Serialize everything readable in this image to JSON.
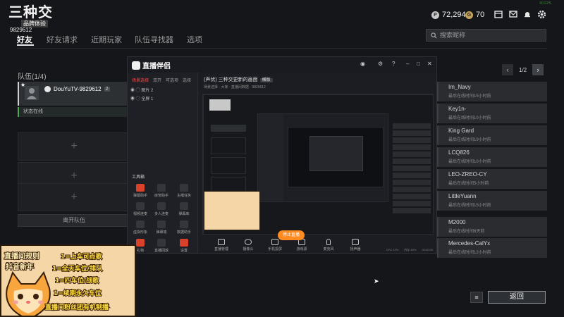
{
  "header": {
    "logo_text": "三种交",
    "logo_sub": "品牌体验",
    "player_id": "9829612",
    "coins": "72,294",
    "gems": "70",
    "fps": "60 FPS"
  },
  "tabs": [
    {
      "label": "好友",
      "active": true
    },
    {
      "label": "好友请求",
      "active": false
    },
    {
      "label": "近期玩家",
      "active": false
    },
    {
      "label": "队伍寻找器",
      "active": false
    },
    {
      "label": "选项",
      "active": false
    }
  ],
  "search": {
    "placeholder": "搜索昵称"
  },
  "party": {
    "title": "队伍(1/4)",
    "member_name": "DouYuTV-9829612",
    "member_level": "2",
    "member_status": "状态在线",
    "leave_label": "离开队伍"
  },
  "pager": {
    "label": "1/2"
  },
  "friends": [
    {
      "name": "Im_Navy",
      "status": "最后在线时间15小时前"
    },
    {
      "name": "Key1n-",
      "status": "最后在线时间10小时前"
    },
    {
      "name": "King Gard",
      "status": "最后在线时间19小时前"
    },
    {
      "name": "LCQ826",
      "status": "最后在线时间10小时前"
    },
    {
      "name": "LEO-ZREO-CY",
      "status": "最后在线时间5小时前"
    },
    {
      "name": "LittleYuann",
      "status": "最后在线时间15小时前"
    },
    {
      "name": "M2000",
      "status": "最后在线时间6天前"
    },
    {
      "name": "Mercedes-CalYx",
      "status": "最后在线时间12小时前"
    }
  ],
  "bottom": {
    "back_label": "返回"
  },
  "stream_app": {
    "app_name": "直播伴侣",
    "scene_tabs": [
      "场景选择",
      "双开",
      "可选项",
      "选择"
    ],
    "scene_items": [
      "图片 2",
      "全屏 1"
    ],
    "tools_title": "工具箱",
    "tools": [
      "弹幕助手",
      "房管助手",
      "主播任务",
      "视频连麦",
      "多人连麦",
      "弹幕库",
      "虚拟形象",
      "弹幕墙",
      "数据助手",
      "礼物",
      "直播回放",
      "设置"
    ],
    "project_title": "(声优) 三种交更新的画面",
    "project_tag": "横版",
    "project_meta": "场景选择 · 大家 · 直播间数据 · 9829612",
    "bottom_buttons": [
      "直播管理",
      "摄像头",
      "手机投屏",
      "游戏源",
      "麦克风",
      "扬声器"
    ],
    "go_live": "停止直播",
    "status": [
      "CPU 12%",
      "内存 46%",
      "00:00:00"
    ]
  },
  "overlay": {
    "lines": [
      "直播间规则",
      "抖音新年",
      "1=上车可点歌",
      "1=全天车位/排队",
      "1=四车位/战歌",
      "1=续期永久车位",
      "直播间粉丝团有机制播"
    ]
  },
  "colors": {
    "background": "#151619",
    "accent_green": "#4fa85a",
    "go_live_orange": "#ff8a1f",
    "overlay_bg": "#f4d6a7"
  }
}
